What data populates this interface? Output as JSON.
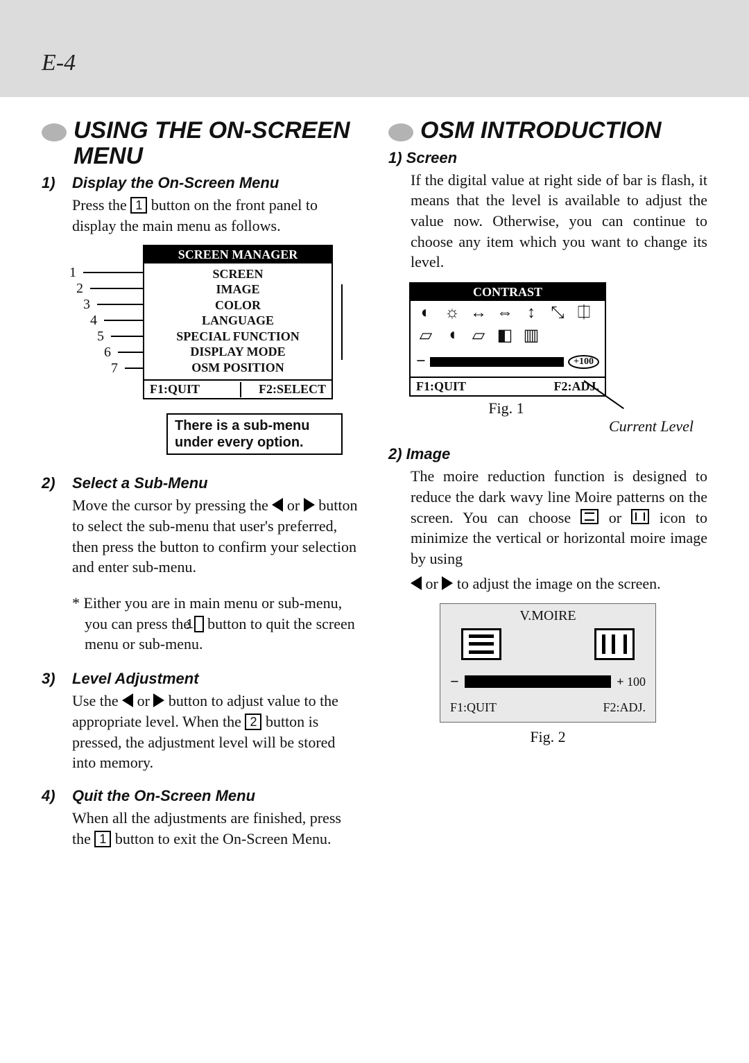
{
  "page_no": "E-4",
  "left": {
    "title": "USING THE ON-SCREEN MENU",
    "s1": {
      "num": "1)",
      "title": "Display the On-Screen Menu",
      "p_a": "Press the ",
      "key1": "1",
      "p_b": " button on the front panel to display the main menu as follows."
    },
    "screen_manager": {
      "title": "SCREEN MANAGER",
      "items": [
        "SCREEN",
        "IMAGE",
        "COLOR",
        "LANGUAGE",
        "SPECIAL FUNCTION",
        "DISPLAY MODE",
        "OSM POSITION"
      ],
      "foot_l": "F1:QUIT",
      "foot_r": "F2:SELECT",
      "labels": [
        "1",
        "2",
        "3",
        "4",
        "5",
        "6",
        "7"
      ]
    },
    "note": "There is a sub-menu under every option.",
    "s2": {
      "num": "2)",
      "title": "Select a Sub-Menu",
      "p_a": "Move the cursor by pressing the ",
      "p_b": " or ",
      "p_c": " button to select the sub-menu that user's preferred, then press the     button to confirm your selection and enter sub-menu.",
      "note_a": "*  Either you are in main menu or sub-menu, you can press the ",
      "note_key": "1",
      "note_b": " button to quit the screen menu or sub-menu."
    },
    "s3": {
      "num": "3)",
      "title": "Level Adjustment",
      "p_a": "Use the ",
      "p_b": " or ",
      "p_c": " button to adjust value to the appropriate level. When the ",
      "key2": "2",
      "p_d": " button is pressed, the adjustment level will be stored into memory."
    },
    "s4": {
      "num": "4)",
      "title": "Quit the On-Screen  Menu",
      "p_a": "When all the adjustments are finished, press the ",
      "key1": "1",
      "p_b": " button to exit the On-Screen Menu."
    }
  },
  "right": {
    "title": "OSM INTRODUCTION",
    "s1": {
      "head": "1) Screen",
      "p": "If the digital value at right side of bar is flash, it means that the level is available to adjust the value now. Otherwise, you can continue to choose any item which you want to change its level."
    },
    "contrast": {
      "title": "CONTRAST",
      "icons": [
        "◐",
        "☼",
        "↔",
        "⇔",
        "↕",
        "⤡",
        "⎅",
        "▱",
        "◖",
        "▱",
        "◧",
        "▥"
      ],
      "value": "100",
      "foot_l": "F1:QUIT",
      "foot_r": "F2:ADJ."
    },
    "fig1": "Fig. 1",
    "current_level": "Current Level",
    "s2": {
      "head": "2) Image",
      "p_a": "The moire reduction function is designed to reduce the dark wavy line Moire patterns on the screen. You can choose ",
      "p_b": "or",
      "p_c": " icon to minimize the vertical or horizontal moire image by using",
      "p_d": "  or  ",
      "p_e": "to adjust the image on the screen."
    },
    "vmoire": {
      "title": "V.MOIRE",
      "value": "100",
      "plus": "+",
      "foot_l": "F1:QUIT",
      "foot_r": "F2:ADJ."
    },
    "fig2": "Fig. 2"
  }
}
